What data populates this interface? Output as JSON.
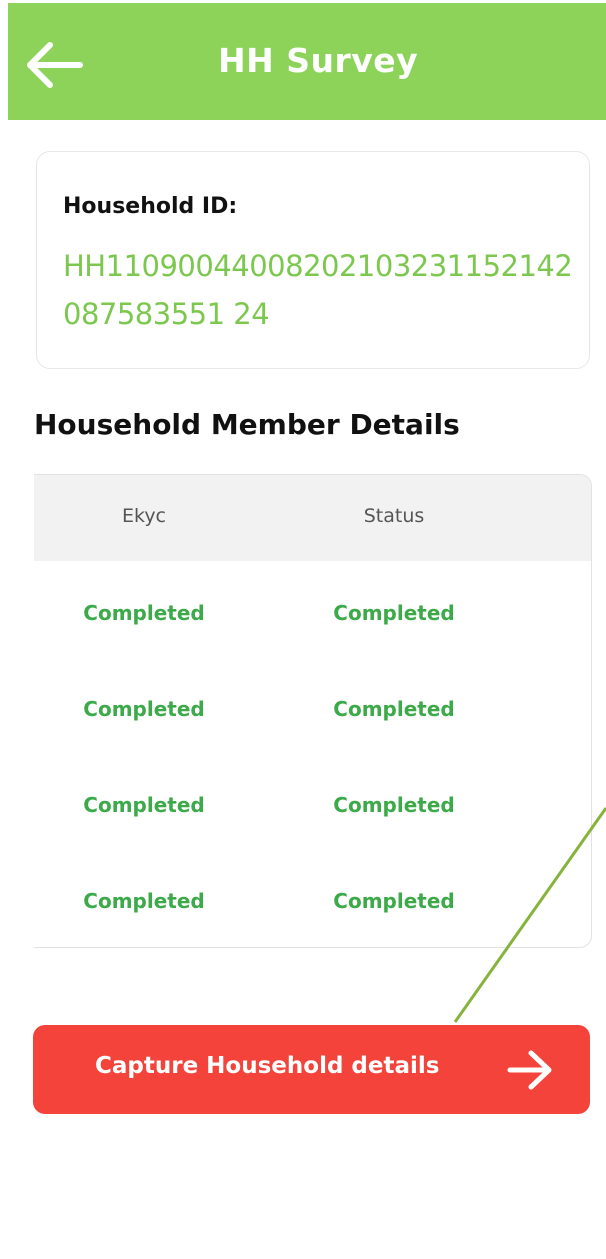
{
  "header": {
    "title": "HH Survey",
    "back_icon": "arrow-left-icon"
  },
  "household": {
    "id_label": "Household ID:",
    "id_value": "HH11090044008202103231152142087583551 24"
  },
  "members": {
    "section_title": "Household Member Details",
    "columns": [
      "Ekyc",
      "Status"
    ],
    "rows": [
      {
        "ekyc": "Completed",
        "status": "Completed"
      },
      {
        "ekyc": "Completed",
        "status": "Completed"
      },
      {
        "ekyc": "Completed",
        "status": "Completed"
      },
      {
        "ekyc": "Completed",
        "status": "Completed"
      }
    ]
  },
  "cta": {
    "label": "Capture Household details",
    "icon": "arrow-right-icon"
  },
  "colors": {
    "appbar": "#8dd35a",
    "id_text": "#7cc84f",
    "status_text": "#3daa4a",
    "cta": "#f3433a",
    "annotation_line": "#86b33c"
  }
}
